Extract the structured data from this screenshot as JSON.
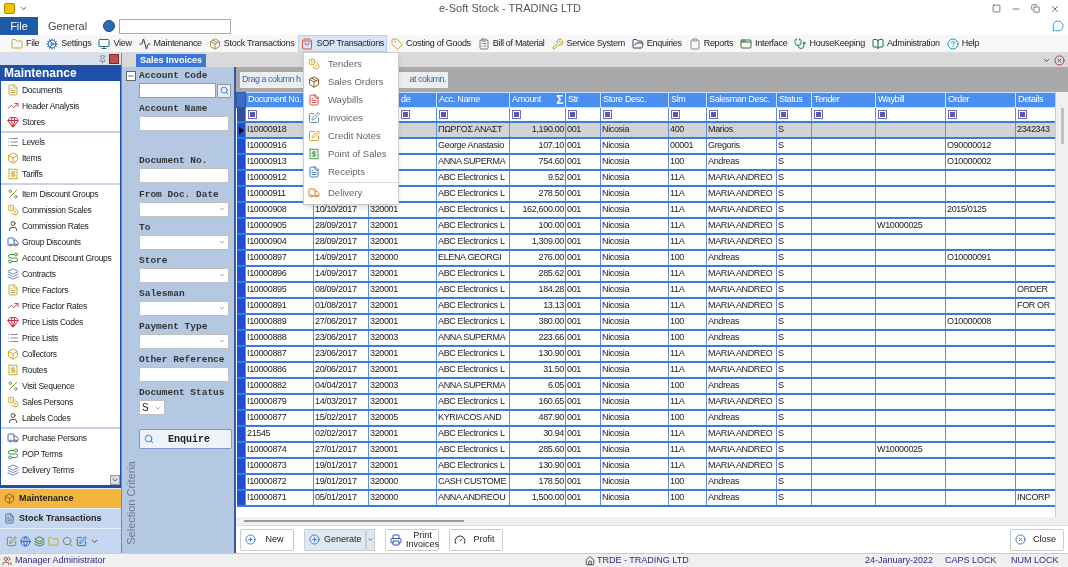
{
  "window": {
    "title": "e-Soft Stock - TRADING LTD"
  },
  "ribbon": {
    "file": "File",
    "tab": "General"
  },
  "toolbar": [
    {
      "label": "File",
      "selected": false
    },
    {
      "label": "Settings",
      "selected": false
    },
    {
      "label": "View",
      "selected": false
    },
    {
      "label": "Maintenance",
      "selected": false
    },
    {
      "label": "Stock Transactions",
      "selected": false
    },
    {
      "label": "SOP Transactions",
      "selected": true
    },
    {
      "label": "Costing of Goods",
      "selected": false
    },
    {
      "label": "Bill of Material",
      "selected": false
    },
    {
      "label": "Service System",
      "selected": false
    },
    {
      "label": "Enquiries",
      "selected": false
    },
    {
      "label": "Reports",
      "selected": false
    },
    {
      "label": "Interface",
      "selected": false
    },
    {
      "label": "HouseKeeping",
      "selected": false
    },
    {
      "label": "Administration",
      "selected": false
    },
    {
      "label": "Help",
      "selected": false
    }
  ],
  "menu": [
    {
      "kind": "item",
      "label": "Tenders"
    },
    {
      "kind": "item",
      "label": "Sales Orders"
    },
    {
      "kind": "item",
      "label": "Waybills"
    },
    {
      "kind": "item",
      "label": "Invoices"
    },
    {
      "kind": "item",
      "label": "Credit Notes"
    },
    {
      "kind": "item",
      "label": "Point of Sales"
    },
    {
      "kind": "item",
      "label": "Receipts"
    },
    {
      "kind": "separator"
    },
    {
      "kind": "item",
      "label": "Delivery"
    }
  ],
  "sidebar": {
    "title": "Maintenance",
    "groups": [
      [
        "Documents",
        "Header Analysis",
        "Stores"
      ],
      [
        "Levels",
        "Items",
        "Tariffs"
      ],
      [
        "Item Discount Groups",
        "Commission Scales",
        "Commission Rates",
        "Group Discounts",
        "Account Discount Groups",
        "Contracts",
        "Price Factors",
        "Price Factor Rates",
        "Price Lists Codes",
        "Price Lists",
        "Collectors",
        "Routes",
        "Visit Sequence",
        "Sales Persons",
        "Labels Codes"
      ],
      [
        "Purchase Persons",
        "POP Terms",
        "Delivery Terms"
      ]
    ],
    "nav": [
      {
        "label": "Maintenance",
        "selected": true
      },
      {
        "label": "Stock Transactions",
        "selected": false
      }
    ]
  },
  "document_tab": {
    "label": "Sales Invoices"
  },
  "criteria": {
    "fields": [
      {
        "label": "Account Code",
        "kind": "lookup"
      },
      {
        "label": "Account Name",
        "kind": "text"
      },
      {
        "label": "Document No.",
        "kind": "text"
      },
      {
        "label": "From Doc. Date",
        "kind": "select"
      },
      {
        "label": "To",
        "kind": "select"
      },
      {
        "label": "Store",
        "kind": "select"
      },
      {
        "label": "Salesman",
        "kind": "select"
      },
      {
        "label": "Payment Type",
        "kind": "select"
      },
      {
        "label": "Other Reference",
        "kind": "text"
      },
      {
        "label": "Document Status",
        "kind": "small_select",
        "value": "S"
      }
    ],
    "button": "Enquire",
    "caption": "Selection Criteria"
  },
  "grid": {
    "group_hint": [
      "Drag a column h",
      "at column."
    ],
    "columns": [
      {
        "label": "Document No.",
        "kind": "text"
      },
      {
        "kind": "text"
      },
      {
        "label": "de",
        "kind": "text"
      },
      {
        "label": "Acc. Name",
        "kind": "text"
      },
      {
        "label": "Amount",
        "kind": "number",
        "sum": "Σ"
      },
      {
        "label": "Str",
        "kind": "text"
      },
      {
        "label": "Store Desc.",
        "kind": "text"
      },
      {
        "label": "Slm",
        "kind": "text"
      },
      {
        "label": "Salesman Desc.",
        "kind": "text"
      },
      {
        "label": "Status",
        "kind": "text"
      },
      {
        "label": "Tender",
        "kind": "text"
      },
      {
        "label": "Waybill",
        "kind": "text"
      },
      {
        "label": "Order",
        "kind": "text"
      },
      {
        "label": "Details",
        "kind": "text"
      }
    ],
    "rows": [
      {
        "selected": true,
        "cells": [
          "I10000918",
          null,
          null,
          "ΠΩΡΓΟΣ ΑΝΑΣΤ",
          "1,190.00",
          "001",
          "Nicosia",
          "400",
          "Marios",
          "S",
          null,
          null,
          null,
          "2342343"
        ]
      },
      {
        "selected": false,
        "cells": [
          "I10000916",
          null,
          null,
          "George Anastasio",
          "107.10",
          "001",
          "Nicosia",
          "00001",
          "Gregoris",
          "S",
          null,
          null,
          "O90000012",
          null
        ]
      },
      {
        "selected": false,
        "cells": [
          "I10000913",
          null,
          null,
          "ANNA SUPERMA",
          "754.60",
          "001",
          "Nicosia",
          "100",
          "Andreas",
          "S",
          null,
          null,
          "O10000002",
          null
        ]
      },
      {
        "selected": false,
        "cells": [
          "I10000912",
          null,
          null,
          "ABC Electronics L",
          "9.52",
          "001",
          "Nicosia",
          "11A",
          "MARIA ANDREO",
          "S",
          null,
          null,
          null,
          null
        ]
      },
      {
        "selected": false,
        "cells": [
          "I10000911",
          null,
          null,
          "ABC Electronics L",
          "278.50",
          "001",
          "Nicosia",
          "11A",
          "MARIA ANDREO",
          "S",
          null,
          null,
          null,
          null
        ]
      },
      {
        "selected": false,
        "cells": [
          "I10000908",
          "10/10/2017",
          "320001",
          "ABC Electronics L",
          "162,600.00",
          "001",
          "Nicosia",
          "11A",
          "MARIA ANDREO",
          "S",
          null,
          null,
          "2015/0125",
          null
        ]
      },
      {
        "selected": false,
        "cells": [
          "I10000905",
          "28/09/2017",
          "320001",
          "ABC Electronics L",
          "100.00",
          "001",
          "Nicosia",
          "11A",
          "MARIA ANDREO",
          "S",
          null,
          "W10000025",
          null,
          null
        ]
      },
      {
        "selected": false,
        "cells": [
          "I10000904",
          "28/09/2017",
          "320001",
          "ABC Electronics L",
          "1,309.00",
          "001",
          "Nicosia",
          "11A",
          "MARIA ANDREO",
          "S",
          null,
          null,
          null,
          null
        ]
      },
      {
        "selected": false,
        "cells": [
          "I10000897",
          "14/09/2017",
          "320000",
          "ELENA GEORGI",
          "276.00",
          "001",
          "Nicosia",
          "100",
          "Andreas",
          "S",
          null,
          null,
          "O10000091",
          null
        ]
      },
      {
        "selected": false,
        "cells": [
          "I10000896",
          "14/09/2017",
          "320001",
          "ABC Electronics L",
          "285.62",
          "001",
          "Nicosia",
          "11A",
          "MARIA ANDREO",
          "S",
          null,
          null,
          null,
          null
        ]
      },
      {
        "selected": false,
        "cells": [
          "I10000895",
          "08/09/2017",
          "320001",
          "ABC Electronics L",
          "184.28",
          "001",
          "Nicosia",
          "11A",
          "MARIA ANDREO",
          "S",
          null,
          null,
          null,
          "ORDER"
        ]
      },
      {
        "selected": false,
        "cells": [
          "I10000891",
          "01/08/2017",
          "320001",
          "ABC Electronics L",
          "13.13",
          "001",
          "Nicosia",
          "11A",
          "MARIA ANDREO",
          "S",
          null,
          null,
          null,
          "FOR OR"
        ]
      },
      {
        "selected": false,
        "cells": [
          "I10000889",
          "27/06/2017",
          "320001",
          "ABC Electronics L",
          "380.00",
          "001",
          "Nicosia",
          "100",
          "Andreas",
          "S",
          null,
          null,
          "O10000008",
          null
        ]
      },
      {
        "selected": false,
        "cells": [
          "I10000888",
          "23/06/2017",
          "320003",
          "ANNA SUPERMA",
          "223.66",
          "001",
          "Nicosia",
          "100",
          "Andreas",
          "S",
          null,
          null,
          null,
          null
        ]
      },
      {
        "selected": false,
        "cells": [
          "I10000887",
          "23/06/2017",
          "320001",
          "ABC Electronics L",
          "130.90",
          "001",
          "Nicosia",
          "11A",
          "MARIA ANDREO",
          "S",
          null,
          null,
          null,
          null
        ]
      },
      {
        "selected": false,
        "cells": [
          "I10000886",
          "20/06/2017",
          "320001",
          "ABC Electronics L",
          "31.50",
          "001",
          "Nicosia",
          "11A",
          "MARIA ANDREO",
          "S",
          null,
          null,
          null,
          null
        ]
      },
      {
        "selected": false,
        "cells": [
          "I10000882",
          "04/04/2017",
          "320003",
          "ANNA SUPERMA",
          "6.05",
          "001",
          "Nicosia",
          "100",
          "Andreas",
          "S",
          null,
          null,
          null,
          null
        ]
      },
      {
        "selected": false,
        "cells": [
          "I10000879",
          "14/03/2017",
          "320001",
          "ABC Electronics L",
          "160.65",
          "001",
          "Nicosia",
          "11A",
          "MARIA ANDREO",
          "S",
          null,
          null,
          null,
          null
        ]
      },
      {
        "selected": false,
        "cells": [
          "I10000877",
          "15/02/2017",
          "320005",
          "KYRIACOS AND",
          "487.90",
          "001",
          "Nicosia",
          "100",
          "Andreas",
          "S",
          null,
          null,
          null,
          null
        ]
      },
      {
        "selected": false,
        "cells": [
          "21545",
          "02/02/2017",
          "320001",
          "ABC Electronics L",
          "30.94",
          "001",
          "Nicosia",
          "11A",
          "MARIA ANDREO",
          "S",
          null,
          null,
          null,
          null
        ]
      },
      {
        "selected": false,
        "cells": [
          "I10000874",
          "27/01/2017",
          "320001",
          "ABC Electronics L",
          "285.60",
          "001",
          "Nicosia",
          "11A",
          "MARIA ANDREO",
          "S",
          null,
          "W10000025",
          null,
          null
        ]
      },
      {
        "selected": false,
        "cells": [
          "I10000873",
          "19/01/2017",
          "320001",
          "ABC Electronics L",
          "130.90",
          "001",
          "Nicosia",
          "11A",
          "MARIA ANDREO",
          "S",
          null,
          null,
          null,
          null
        ]
      },
      {
        "selected": false,
        "cells": [
          "I10000872",
          "19/01/2017",
          "320000",
          "CASH CUSTOME",
          "178.50",
          "001",
          "Nicosia",
          "100",
          "Andreas",
          "S",
          null,
          null,
          null,
          null
        ]
      },
      {
        "selected": false,
        "cells": [
          "I10000871",
          "05/01/2017",
          "320000",
          "ANNA ANDREOU",
          "1,500.00",
          "001",
          "Nicosia",
          "100",
          "Andreas",
          "S",
          null,
          null,
          null,
          "INCORP"
        ]
      }
    ]
  },
  "buttons": [
    {
      "label": "New",
      "kind": "new",
      "dropdown": false
    },
    {
      "label": "Generate",
      "kind": "generate",
      "dropdown": true
    },
    {
      "label": "Print Invoices",
      "kind": "print",
      "dropdown": false
    },
    {
      "label": "Profit",
      "kind": "profit",
      "dropdown": false
    }
  ],
  "close_button": {
    "label": "Close"
  },
  "status_bar": {
    "user": "Manager Administrator",
    "company": "TRDE - TRADING LTD",
    "date": "24-January-2022",
    "caps": "CAPS LOCK",
    "num": "NUM LOCK"
  }
}
